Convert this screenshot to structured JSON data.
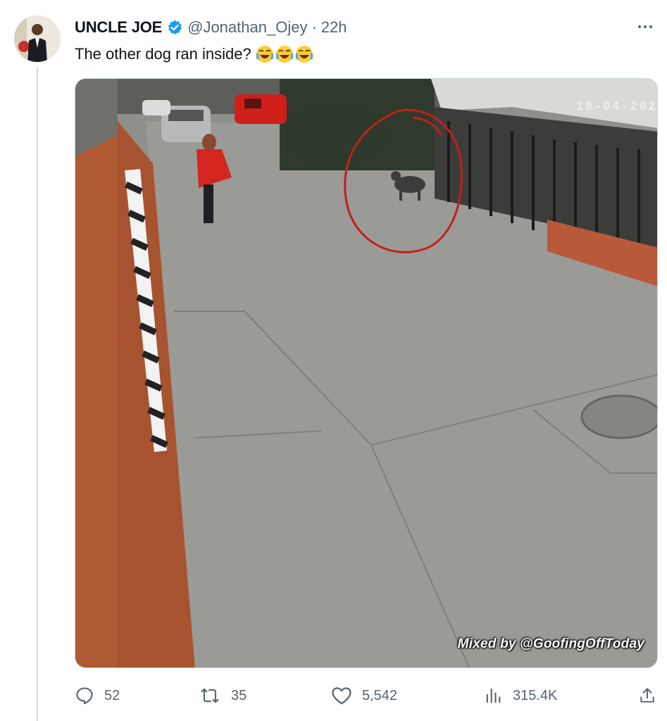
{
  "tweet": {
    "display_name": "UNCLE JOE",
    "handle": "@Jonathan_Ojey",
    "separator": "·",
    "time": "22h",
    "text": "The other dog ran inside?",
    "emojis": [
      "😂",
      "😂",
      "😂"
    ],
    "media": {
      "watermark": "Mixed by @GoofingOffToday",
      "camera_timestamp": "18-04-202"
    }
  },
  "actions": {
    "replies": "52",
    "retweets": "35",
    "likes": "5,542",
    "views": "315.4K"
  },
  "icons": {
    "verified": "verified-badge-icon",
    "more": "more-icon",
    "reply": "reply-icon",
    "retweet": "retweet-icon",
    "like": "heart-icon",
    "views": "views-icon",
    "share": "share-icon"
  },
  "colors": {
    "verified": "#1d9bf0",
    "secondary_text": "#536471",
    "annotation_circle": "#c0201a"
  }
}
